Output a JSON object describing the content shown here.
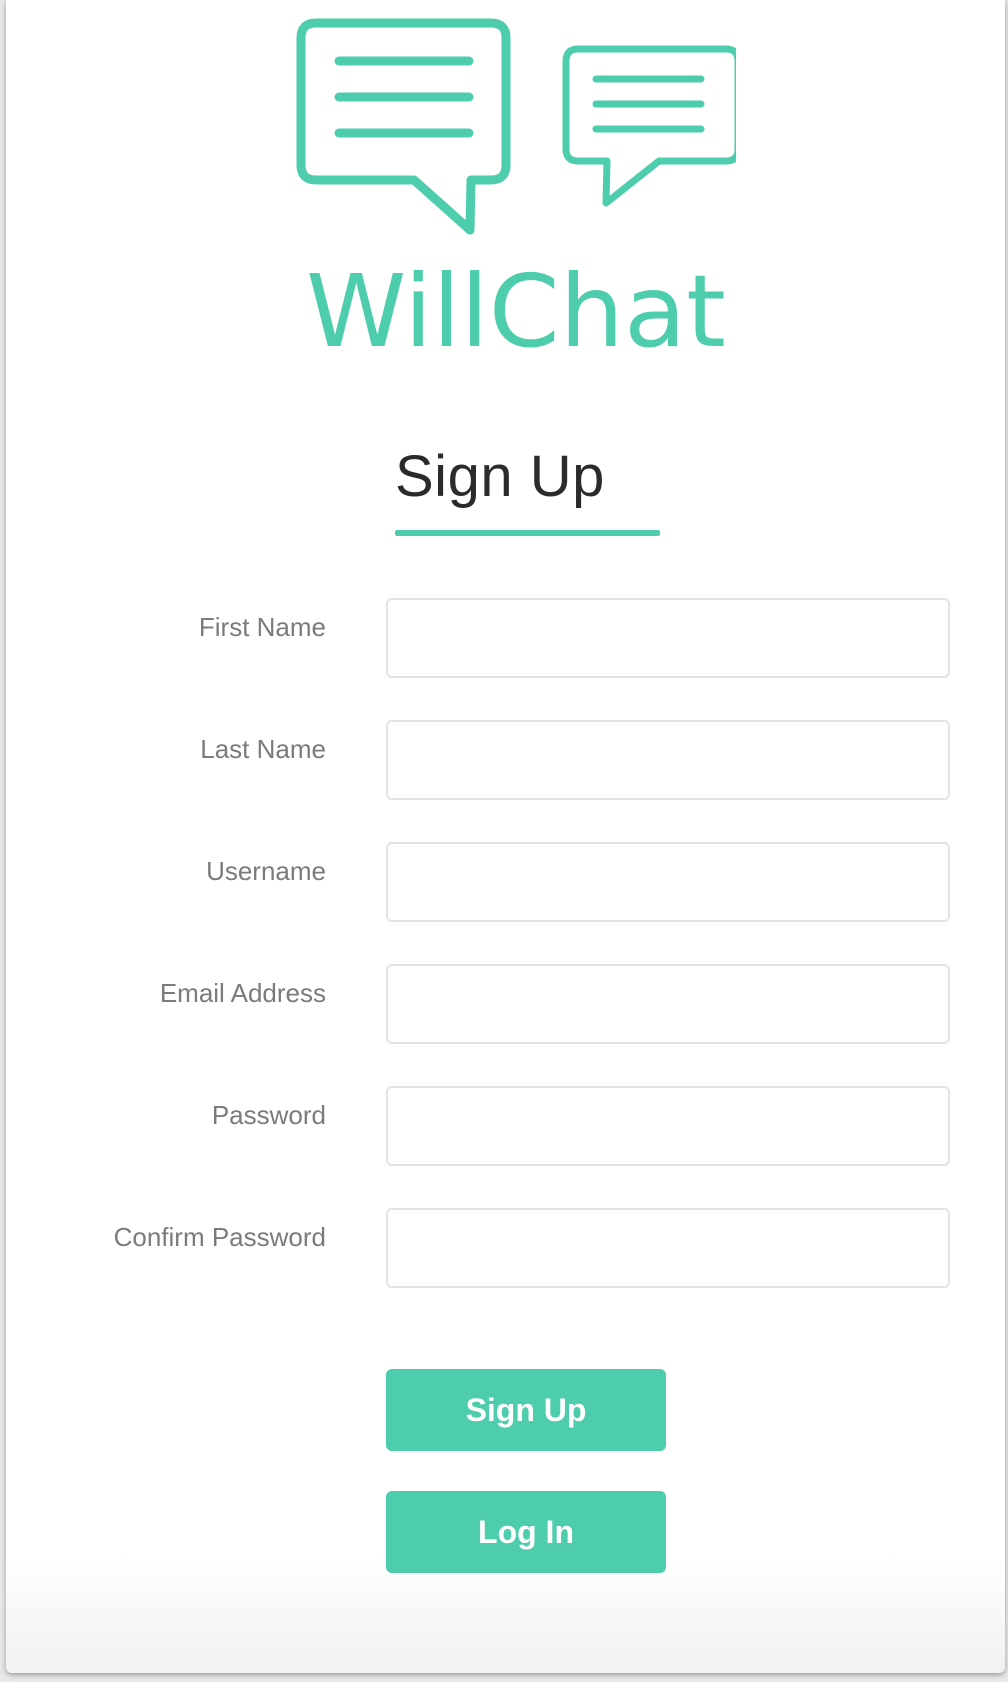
{
  "brand": {
    "name": "WillChat",
    "accent_color": "#4dcdac"
  },
  "form": {
    "title": "Sign Up",
    "fields": [
      {
        "label": "First Name",
        "value": "",
        "placeholder": ""
      },
      {
        "label": "Last Name",
        "value": "",
        "placeholder": ""
      },
      {
        "label": "Username",
        "value": "",
        "placeholder": ""
      },
      {
        "label": "Email Address",
        "value": "",
        "placeholder": ""
      },
      {
        "label": "Password",
        "value": "",
        "placeholder": ""
      },
      {
        "label": "Confirm Password",
        "value": "",
        "placeholder": ""
      }
    ]
  },
  "buttons": {
    "signup_label": "Sign Up",
    "login_label": "Log In"
  }
}
